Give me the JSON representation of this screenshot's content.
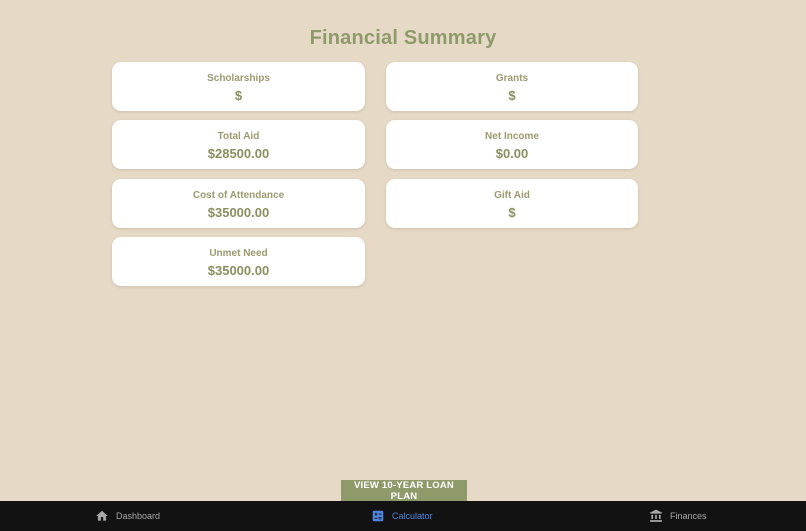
{
  "page": {
    "title": "Financial Summary"
  },
  "cards": {
    "scholarships": {
      "label": "Scholarships",
      "value": "$"
    },
    "grants": {
      "label": "Grants",
      "value": "$"
    },
    "total_aid": {
      "label": "Total Aid",
      "value": "$28500.00"
    },
    "net_income": {
      "label": "Net Income",
      "value": "$0.00"
    },
    "cost_of_attendance": {
      "label": "Cost of Attendance",
      "value": "$35000.00"
    },
    "gift_aid": {
      "label": "Gift Aid",
      "value": "$"
    },
    "unmet_need": {
      "label": "Unmet Need",
      "value": "$35000.00"
    }
  },
  "loan_button": {
    "label": "VIEW 10-YEAR LOAN PLAN"
  },
  "tabbar": {
    "tabs": [
      {
        "label": "Dashboard",
        "icon": "home-icon",
        "active": false
      },
      {
        "label": "Calculator",
        "icon": "calculator-icon",
        "active": true
      },
      {
        "label": "Finances",
        "icon": "bank-icon",
        "active": false
      }
    ]
  },
  "colors": {
    "background": "#e6dac6",
    "accent": "#8f9a6b",
    "card": "#ffffff",
    "tabbar": "#121212",
    "active_tab": "#4f86df"
  }
}
